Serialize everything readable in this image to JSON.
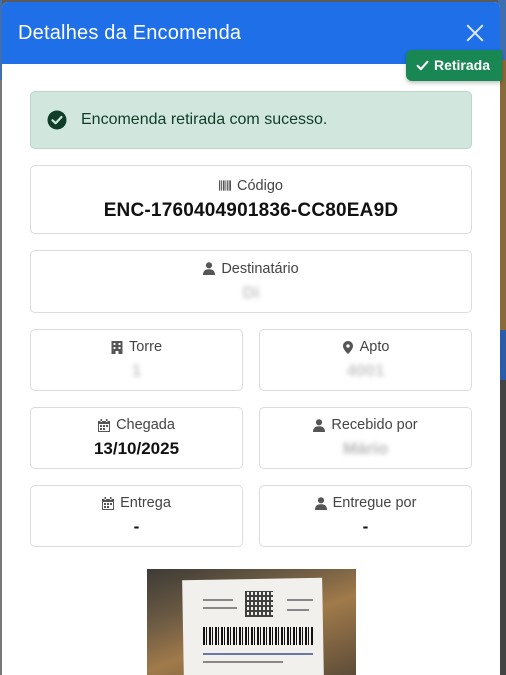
{
  "modal": {
    "title": "Detalhes da Encomenda",
    "status_badge": "Retirada"
  },
  "alert": {
    "message": "Encomenda retirada com sucesso."
  },
  "fields": {
    "codigo": {
      "label": "Código",
      "value": "ENC-1760404901836-CC80EA9D"
    },
    "destinatario": {
      "label": "Destinatário",
      "value": "Di"
    },
    "torre": {
      "label": "Torre",
      "value": "1"
    },
    "apto": {
      "label": "Apto",
      "value": "4001"
    },
    "chegada": {
      "label": "Chegada",
      "value": "13/10/2025"
    },
    "recebido_por": {
      "label": "Recebido por",
      "value": "Mário"
    },
    "entrega": {
      "label": "Entrega",
      "value": "-"
    },
    "entregue_por": {
      "label": "Entregue por",
      "value": "-"
    }
  },
  "colors": {
    "header": "#1e6fe8",
    "badge": "#198754",
    "alert_bg": "#d1e7dd"
  },
  "icons": {
    "close": "close-icon",
    "badge": "check-icon",
    "alert": "check-circle-icon",
    "codigo": "barcode-icon",
    "destinatario": "user-icon",
    "torre": "building-icon",
    "apto": "map-pin-icon",
    "chegada": "calendar-icon",
    "recebido_por": "user-icon",
    "entrega": "calendar-icon",
    "entregue_por": "user-icon"
  }
}
